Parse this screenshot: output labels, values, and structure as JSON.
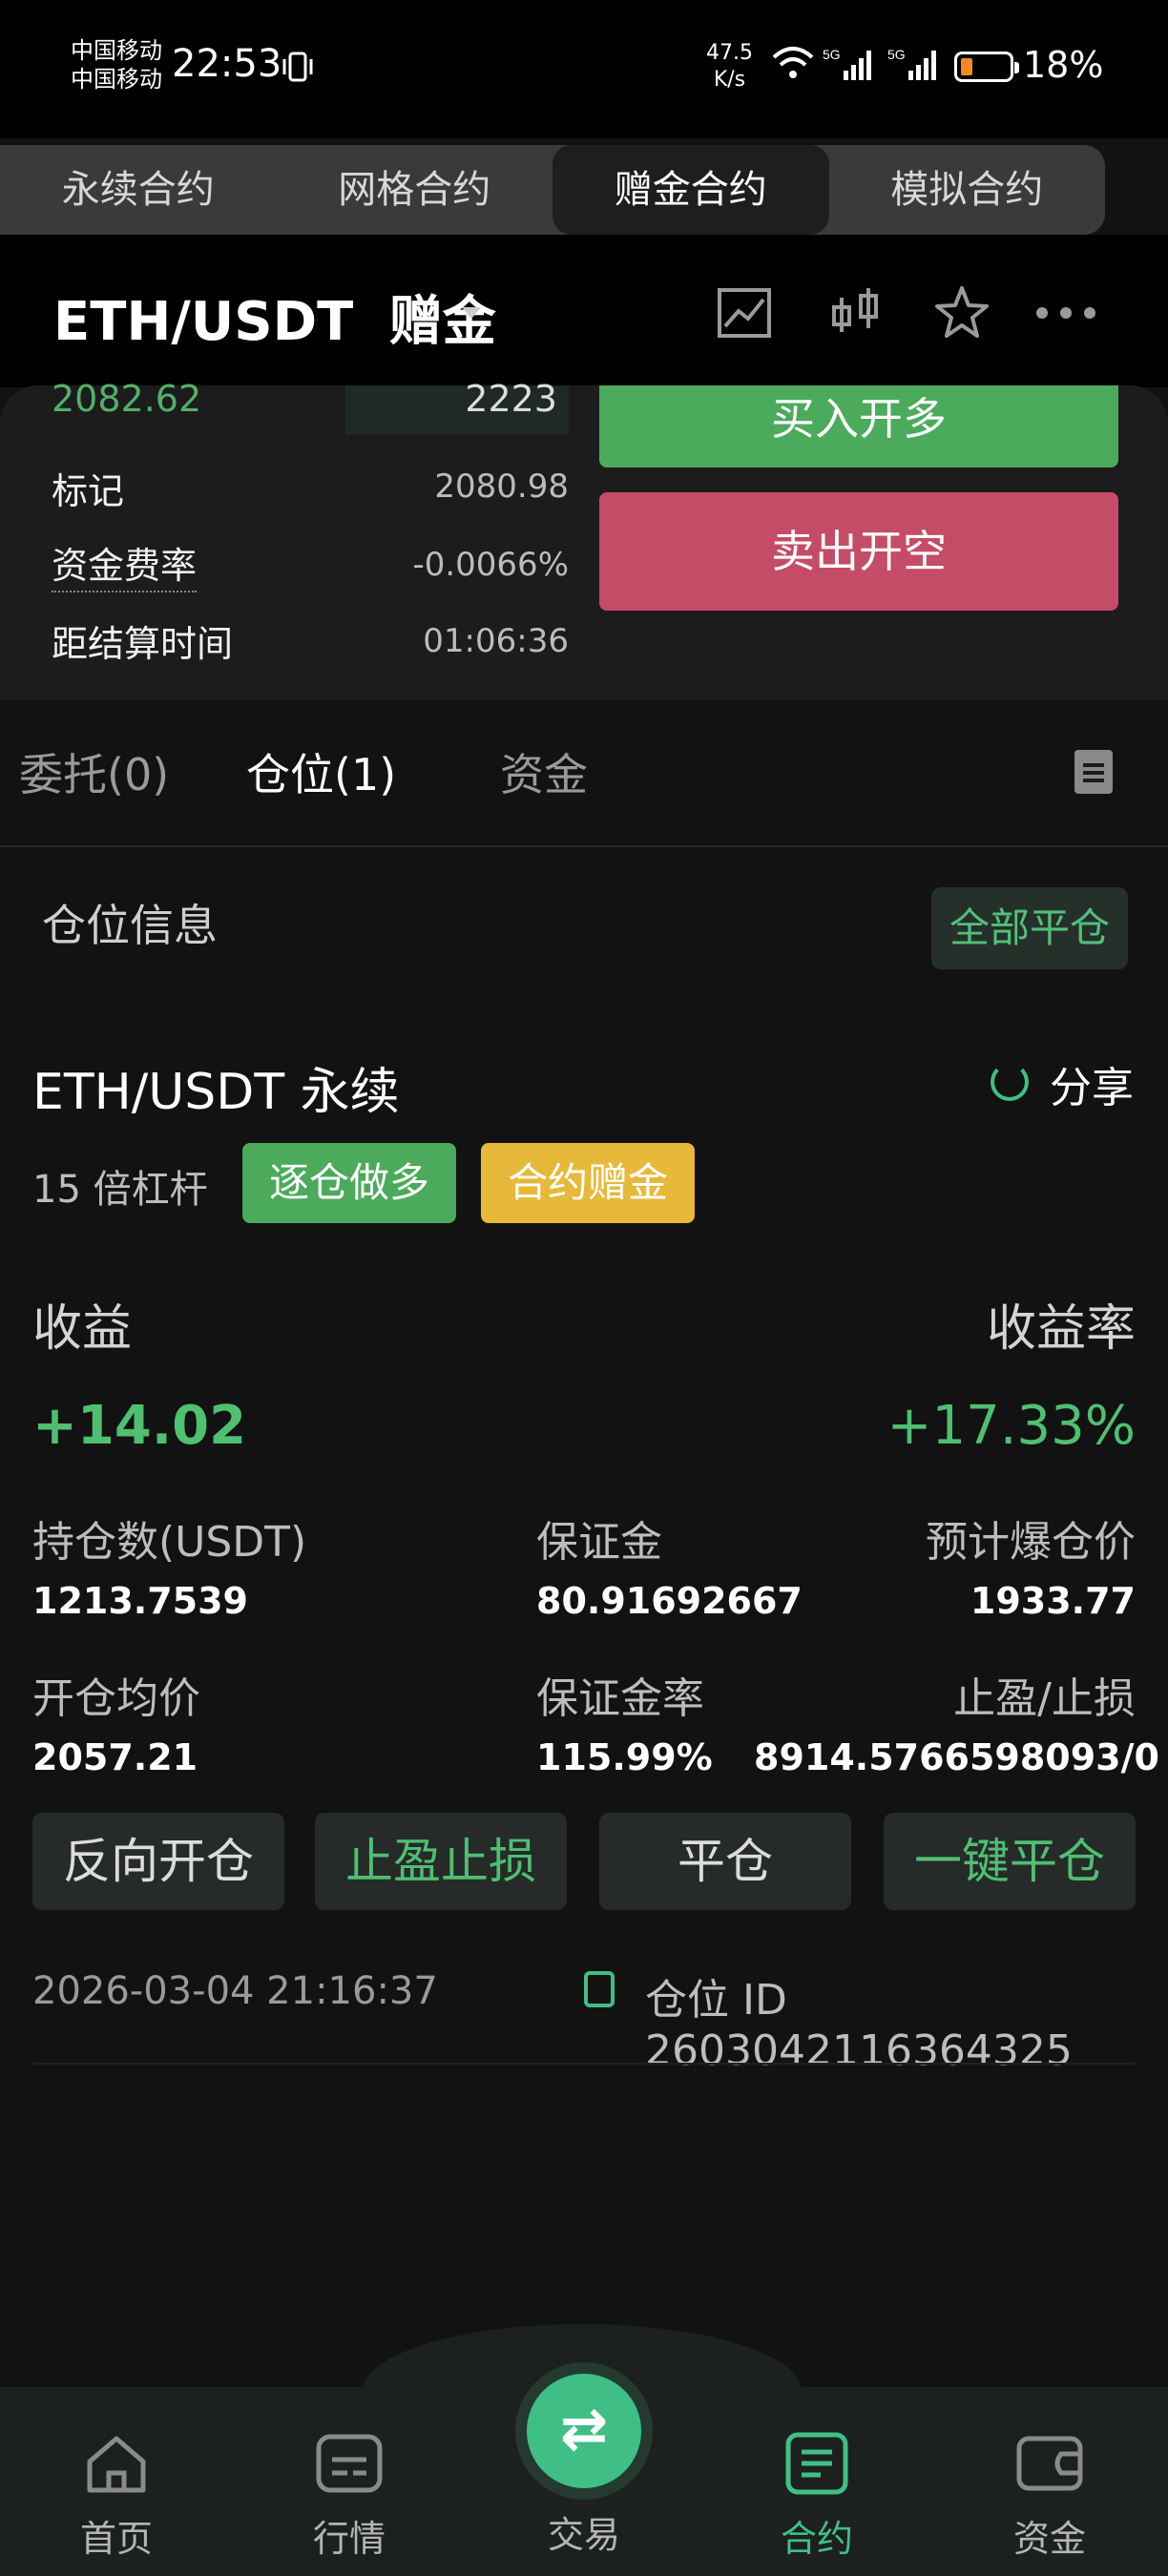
{
  "status_bar": {
    "carrier_1": "中国移动",
    "carrier_2": "中国移动",
    "time": "22:53",
    "net_speed_value": "47.5",
    "net_speed_unit": "K/s",
    "battery": "18%",
    "battery_color": "#f08a24"
  },
  "top_tabs": [
    "永续合约",
    "网格合约",
    "赠金合约",
    "模拟合约"
  ],
  "top_tab_active": 2,
  "header": {
    "pair": "ETH/USDT",
    "type": "赠金"
  },
  "market": {
    "last_price": "2082.62",
    "depth_value": "2223",
    "mark_label": "标记",
    "mark_value": "2080.98",
    "funding_label": "资金费率",
    "funding_value": "-0.0066%",
    "settle_label": "距结算时间",
    "settle_value": "01:06:36",
    "buy_label": "买入开多",
    "sell_label": "卖出开空"
  },
  "sub_tabs": {
    "orders": "委托(0)",
    "positions": "仓位(1)",
    "funds": "资金"
  },
  "position_section": {
    "title": "仓位信息",
    "close_all": "全部平仓"
  },
  "position": {
    "title": "ETH/USDT 永续",
    "share": "分享",
    "leverage": "15 倍杠杆",
    "tag_mode": "逐仓做多",
    "tag_bonus": "合约赠金",
    "pnl_label": "收益",
    "pnl_value": "+14.02",
    "roe_label": "收益率",
    "roe_value": "+17.33%",
    "size_label": "持仓数(USDT)",
    "size_value": "1213.7539",
    "margin_label": "保证金",
    "margin_value": "80.91692667",
    "liq_label": "预计爆仓价",
    "liq_value": "1933.77",
    "entry_label": "开仓均价",
    "entry_value": "2057.21",
    "margin_ratio_label": "保证金率",
    "margin_ratio_value": "115.99%",
    "tpsl_label": "止盈/止损",
    "tpsl_value": "8914.5766598093/0",
    "btn_reverse": "反向开仓",
    "btn_tpsl": "止盈止损",
    "btn_close": "平仓",
    "btn_quick_close": "一键平仓",
    "opened_at": "2026-03-04 21:16:37",
    "position_id": "仓位 ID 2603042116364325"
  },
  "bottom_nav": [
    {
      "label": "首页",
      "icon": "home-icon"
    },
    {
      "label": "行情",
      "icon": "market-icon"
    },
    {
      "label": "交易",
      "icon": "trade-swap-icon"
    },
    {
      "label": "合约",
      "icon": "contract-icon"
    },
    {
      "label": "资金",
      "icon": "wallet-icon"
    }
  ],
  "colors": {
    "accent_green": "#4fbf72",
    "buy_green": "#4caa5c",
    "sell_red": "#c54c66",
    "bonus_gold": "#e6b93a"
  }
}
